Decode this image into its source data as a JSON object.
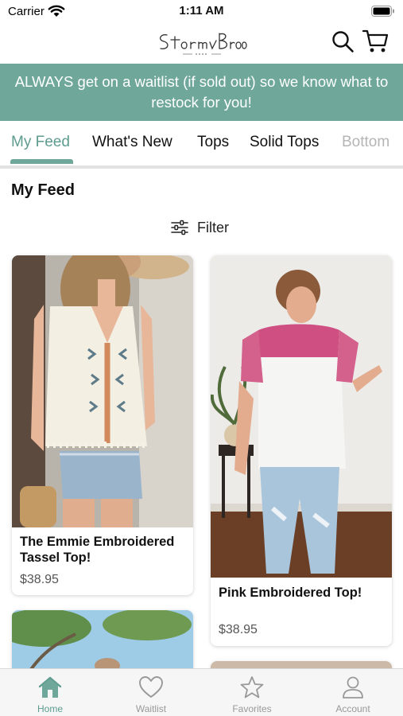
{
  "status_bar": {
    "carrier": "Carrier",
    "time": "1:11 AM"
  },
  "header": {
    "logo_alt": "Stormy Brooke Designs"
  },
  "announcement": {
    "line1": "ALWAYS get on a waitlist (if sold out) so we know what to",
    "line2": "restock for you!"
  },
  "tabs": [
    {
      "label": "My Feed"
    },
    {
      "label": "What's New"
    },
    {
      "label": "Tops"
    },
    {
      "label": "Solid Tops"
    },
    {
      "label": "Bottom"
    }
  ],
  "active_tab": "My Feed",
  "feed_title": "My Feed",
  "filter_label": "Filter",
  "products": [
    {
      "name_line1": "The Emmie Embroidered",
      "name_line2": "Tassel Top!",
      "price": "$38.95"
    },
    {
      "name_line1": "Pink Embroidered Top!",
      "name_line2": "",
      "price": "$38.95"
    }
  ],
  "bottom_nav": [
    {
      "label": "Home",
      "icon": "home-icon"
    },
    {
      "label": "Waitlist",
      "icon": "heart-icon"
    },
    {
      "label": "Favorites",
      "icon": "star-icon"
    },
    {
      "label": "Account",
      "icon": "person-icon"
    }
  ],
  "colors": {
    "accent": "#6fa89b",
    "accent_text": "#5d9c8e",
    "nav_inactive": "#999999"
  }
}
